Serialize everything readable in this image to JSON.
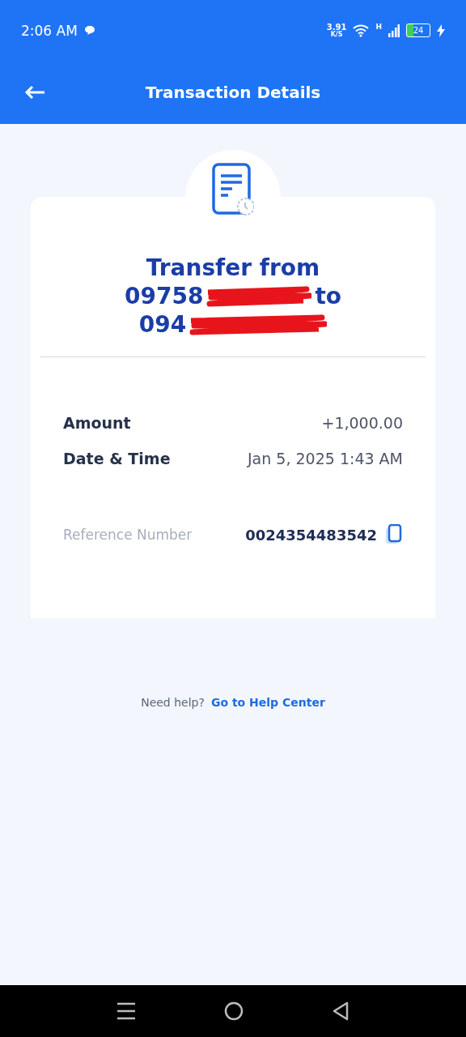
{
  "status_bar": {
    "time": "2:06 AM",
    "net_speed": "3.91",
    "net_unit": "K/S",
    "network_type": "H",
    "battery": "24"
  },
  "header": {
    "title": "Transaction Details"
  },
  "receipt": {
    "title_line": "Transfer from",
    "from_prefix": "09758",
    "joiner": "to",
    "to_prefix": "094",
    "rows": [
      {
        "label": "Amount",
        "value": "+1,000.00"
      },
      {
        "label": "Date & Time",
        "value": "Jan 5, 2025 1:43 AM"
      }
    ],
    "reference": {
      "label": "Reference Number",
      "value": "0024354483542"
    }
  },
  "help": {
    "prompt": "Need help?",
    "link": "Go to Help Center"
  }
}
